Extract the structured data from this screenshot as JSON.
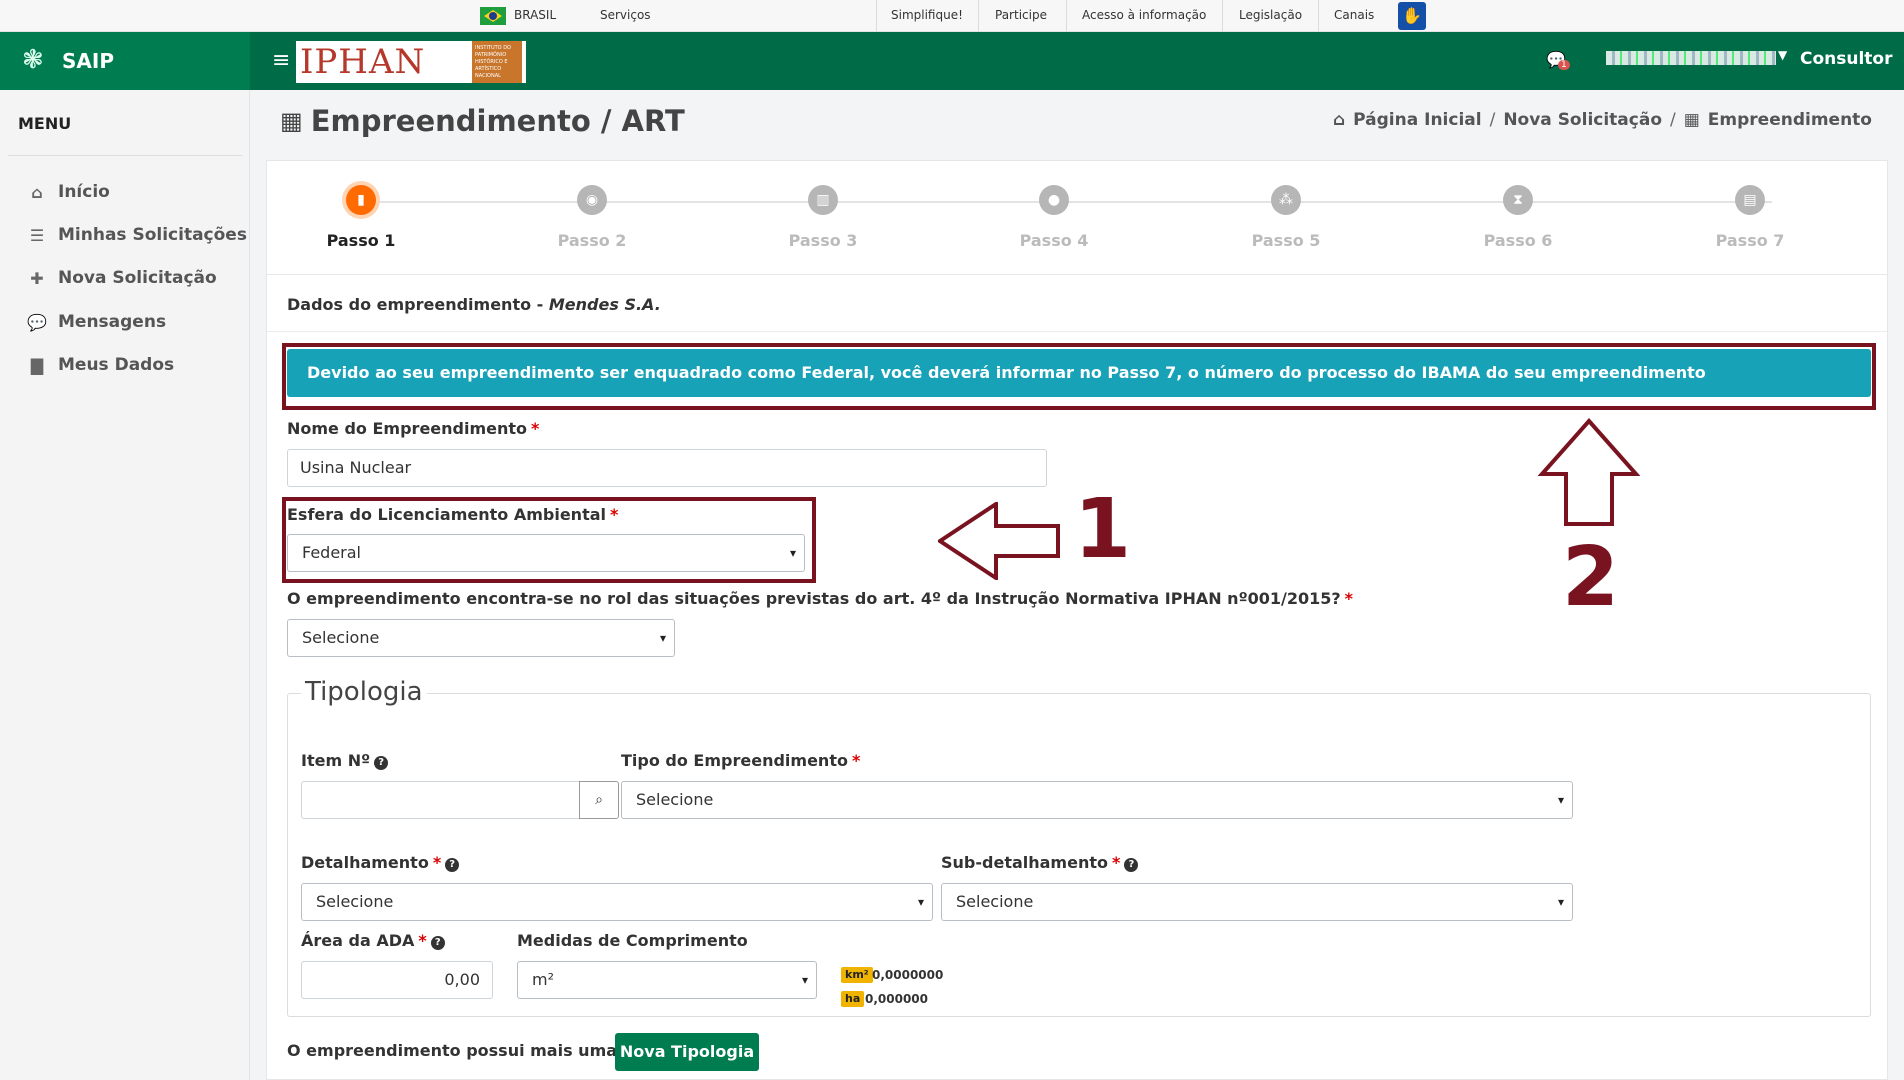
{
  "govbar": {
    "country": "BRASIL",
    "servicos": "Serviços",
    "links": [
      "Simplifique!",
      "Participe",
      "Acesso à informação",
      "Legislação",
      "Canais"
    ]
  },
  "brand": {
    "name": "SAIP"
  },
  "topbar": {
    "logo_text": "IPHAN",
    "logo_tag": "INSTITUTO DO PATRIMÔNIO HISTÓRICO E ARTÍSTICO NACIONAL",
    "chat_badge": "1",
    "role": "Consultor"
  },
  "sidebar": {
    "title": "MENU",
    "items": [
      {
        "icon": "home-icon",
        "glyph": "⌂",
        "label": "Início"
      },
      {
        "icon": "list-icon",
        "glyph": "☰",
        "label": "Minhas Solicitações"
      },
      {
        "icon": "plus-icon",
        "glyph": "✚",
        "label": "Nova Solicitação"
      },
      {
        "icon": "comments-icon",
        "glyph": "💬",
        "label": "Mensagens"
      },
      {
        "icon": "file-icon",
        "glyph": "▇",
        "label": "Meus Dados"
      }
    ]
  },
  "page": {
    "title": "Empreendimento / ART",
    "breadcrumb": [
      "Página Inicial",
      "Nova Solicitação",
      "Empreendimento"
    ]
  },
  "stepper": {
    "steps": [
      "Passo 1",
      "Passo 2",
      "Passo 3",
      "Passo 4",
      "Passo 5",
      "Passo 6",
      "Passo 7"
    ],
    "active_index": 0
  },
  "form": {
    "section_label": "Dados do empreendimento - ",
    "section_company": "Mendes S.A.",
    "alert": "Devido ao seu empreendimento ser enquadrado como Federal, você deverá informar no Passo 7, o número do processo do IBAMA do seu empreendimento",
    "nome_label": "Nome do Empreendimento",
    "nome_value": "Usina Nuclear",
    "esfera_label": "Esfera do Licenciamento Ambiental",
    "esfera_value": "Federal",
    "rol_label": "O empreendimento encontra-se no rol das situações previstas do art. 4º da Instrução Normativa IPHAN nº001/2015?",
    "rol_value": "Selecione",
    "tipologia_legend": "Tipologia",
    "item_label": "Item Nº",
    "item_value": "",
    "tipo_label": "Tipo do Empreendimento",
    "tipo_value": "Selecione",
    "detalhamento_label": "Detalhamento",
    "detalhamento_value": "Selecione",
    "subdetalhamento_label": "Sub-detalhamento",
    "subdetalhamento_value": "Selecione",
    "area_label": "Área da ADA",
    "area_value": "0,00",
    "medidas_label": "Medidas de Comprimento",
    "medidas_value": "m²",
    "km2_label": "km²",
    "km2_value": "0,0000000",
    "ha_label": "ha",
    "ha_value": "0,000000",
    "mais_label": "O empreendimento possui mais uma tipologia?",
    "nova_btn": "Nova Tipologia"
  },
  "annotations": {
    "one": "1",
    "two": "2",
    "color": "#7a1320"
  },
  "colors": {
    "brand_green": "#007c51",
    "alert_teal": "#17a2b8",
    "step_active": "#ff6b00"
  }
}
